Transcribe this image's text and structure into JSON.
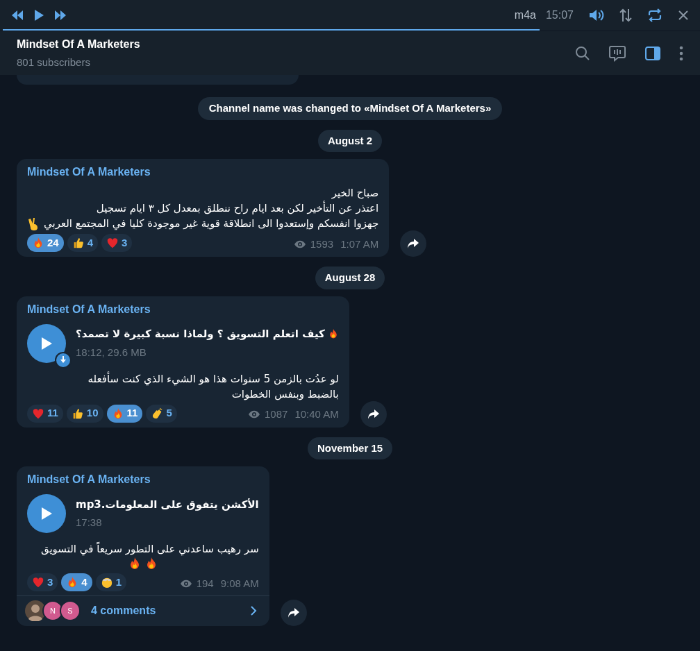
{
  "player": {
    "track": "m4a",
    "time": "15:07",
    "level": 0.77
  },
  "header": {
    "title": "Mindset Of A Marketers",
    "subtitle": "801 subscribers"
  },
  "feed": [
    {
      "kind": "service",
      "text": "Channel name was changed to «Mindset Of A Marketers»"
    },
    {
      "kind": "date",
      "text": "August 2"
    },
    {
      "kind": "post",
      "author": "Mindset Of A Marketers",
      "text": "صباح الخير\nاعتذر عن التأخير لكن بعد ايام راح ننطلق بمعدل كل ٣ ايام تسجيل\nجهزوا انفسكم وإستعدوا الى انطلاقة قوية غير موجودة كليا في المجتمع العربي",
      "inline_emojis": [
        {
          "kind": "victory"
        }
      ],
      "reactions": [
        {
          "kind": "fire",
          "count": "24",
          "selected": true
        },
        {
          "kind": "thumbs",
          "count": "4",
          "selected": false
        },
        {
          "kind": "heart",
          "count": "3",
          "selected": false
        }
      ],
      "views": "1593",
      "time": "1:07 AM"
    },
    {
      "kind": "date",
      "text": "August 28"
    },
    {
      "kind": "post",
      "author": "Mindset Of A Marketers",
      "audio": {
        "title": "كيف اتعلم التسويق ؟ ولماذا نسبة كبيرة لا تصمد؟",
        "title_icon": {
          "kind": "fire"
        },
        "meta": "18:12, 29.6 MB",
        "download_badge": true
      },
      "text": "لو عدُت بالزمن 5 سنوات هذا هو الشيء الذي كنت سأفعله\nبالضبط وبنفس الخطوات",
      "reactions": [
        {
          "kind": "heart",
          "count": "11",
          "selected": false
        },
        {
          "kind": "thumbs",
          "count": "10",
          "selected": false
        },
        {
          "kind": "fire",
          "count": "11",
          "selected": true
        },
        {
          "kind": "clap",
          "count": "5",
          "selected": false
        }
      ],
      "views": "1087",
      "time": "10:40 AM"
    },
    {
      "kind": "date",
      "text": "November 15"
    },
    {
      "kind": "post",
      "author": "Mindset Of A Marketers",
      "audio": {
        "title": "الأكشن يتفوق على المعلومات.mp3",
        "meta": "17:38",
        "download_badge": false
      },
      "text": "سر رهيب ساعدني على التطور سريعاً في التسويق",
      "emoji_line": [
        {
          "kind": "fire"
        },
        {
          "kind": "fire"
        }
      ],
      "reactions": [
        {
          "kind": "heart",
          "count": "3",
          "selected": false
        },
        {
          "kind": "fire",
          "count": "4",
          "selected": true
        },
        {
          "kind": "mindblown",
          "count": "1",
          "selected": false
        }
      ],
      "views": "194",
      "time": "9:08 AM",
      "comments": {
        "avatars": [
          {
            "kind": "photo"
          },
          {
            "kind": "letter",
            "letter": "N",
            "color": "#d15a8f"
          },
          {
            "kind": "letter",
            "letter": "S",
            "color": "#d15a8f"
          }
        ],
        "label": "4 comments"
      }
    }
  ]
}
